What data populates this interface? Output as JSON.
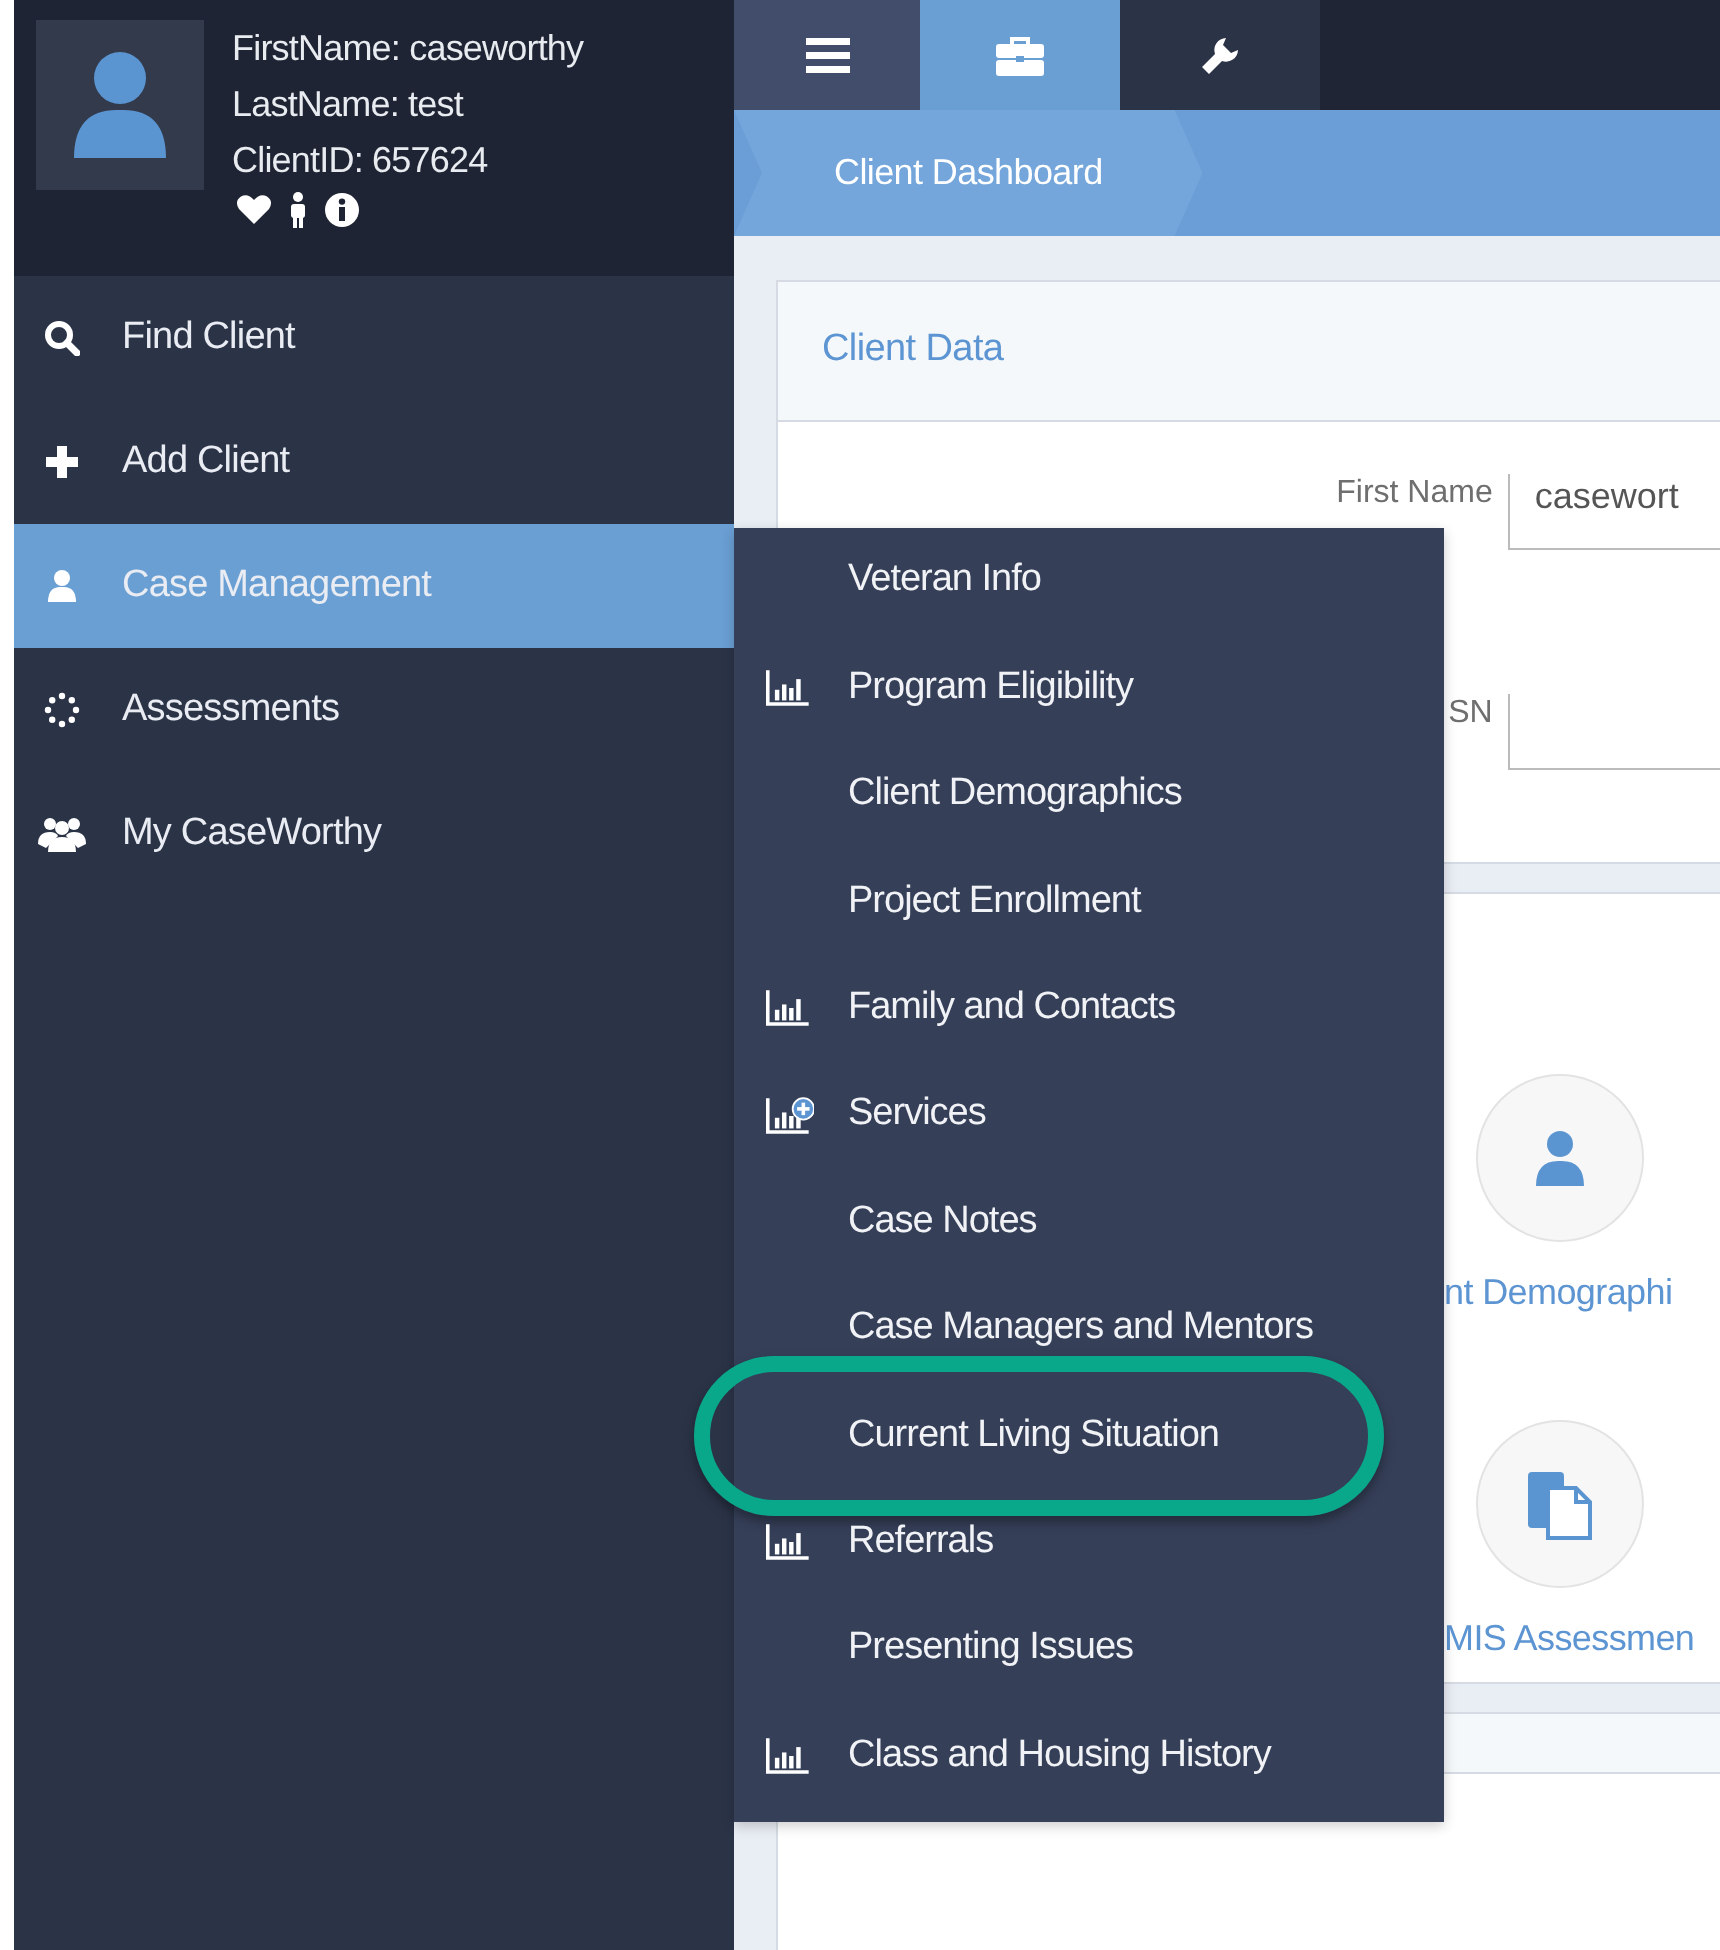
{
  "client": {
    "first_name": "FirstName: caseworthy",
    "last_name": "LastName: test",
    "client_id": "ClientID: 657624"
  },
  "toolbar_tabs": [
    {
      "kind": "menu",
      "selected": false
    },
    {
      "kind": "briefcase",
      "selected": true
    },
    {
      "kind": "wrench",
      "selected": false
    }
  ],
  "breadcrumb": "Client Dashboard",
  "sidebar": {
    "items": [
      {
        "label": "Find Client",
        "kind": "search",
        "selected": false
      },
      {
        "label": "Add Client",
        "kind": "plus",
        "selected": false
      },
      {
        "label": "Case Management",
        "kind": "person",
        "selected": true
      },
      {
        "label": "Assessments",
        "kind": "dots",
        "selected": false
      },
      {
        "label": "My CaseWorthy",
        "kind": "group",
        "selected": false
      }
    ]
  },
  "flyout": {
    "items": [
      {
        "label": "Veteran Info",
        "kind": "plain",
        "highlighted": false
      },
      {
        "label": "Program Eligibility",
        "kind": "chart",
        "highlighted": false
      },
      {
        "label": "Client Demographics",
        "kind": "plain",
        "highlighted": false
      },
      {
        "label": "Project Enrollment",
        "kind": "plain",
        "highlighted": false
      },
      {
        "label": "Family and Contacts",
        "kind": "chart",
        "highlighted": false
      },
      {
        "label": "Services",
        "kind": "chart-plus",
        "highlighted": false
      },
      {
        "label": "Case Notes",
        "kind": "plain",
        "highlighted": false
      },
      {
        "label": "Case Managers and Mentors",
        "kind": "plain",
        "highlighted": false
      },
      {
        "label": "Current Living Situation",
        "kind": "plain",
        "highlighted": true
      },
      {
        "label": "Referrals",
        "kind": "chart",
        "highlighted": false
      },
      {
        "label": "Presenting Issues",
        "kind": "plain",
        "highlighted": false
      },
      {
        "label": "Class and Housing History",
        "kind": "chart",
        "highlighted": false
      }
    ]
  },
  "client_data": {
    "title": "Client Data",
    "fields": [
      {
        "label": "First Name",
        "value": "casewort"
      },
      {
        "label": "SN"
      }
    ]
  },
  "tiles": [
    {
      "label": "nt Demographi",
      "kind": "person"
    },
    {
      "label": "MIS Assessmen",
      "kind": "document"
    }
  ]
}
